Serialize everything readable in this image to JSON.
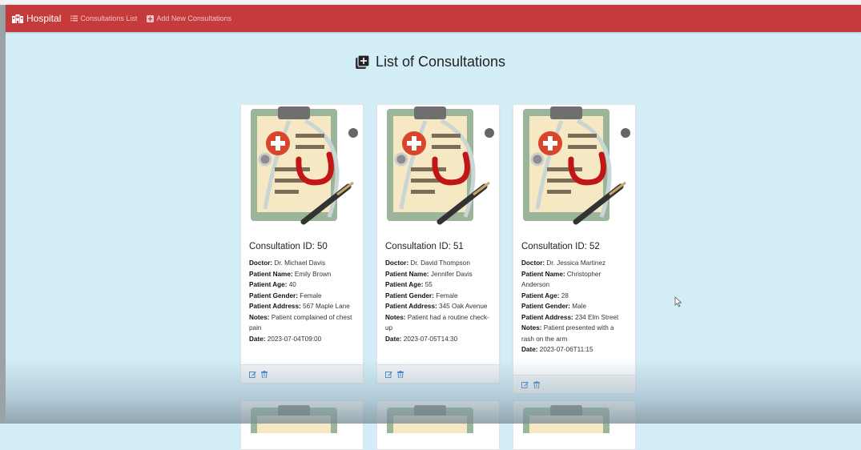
{
  "navbar": {
    "brand": "Hospital",
    "links": [
      {
        "label": "Consultations List",
        "icon": "list-icon"
      },
      {
        "label": "Add New Consultations",
        "icon": "plus-square-icon"
      }
    ],
    "bg_color": "#c53b3b"
  },
  "page": {
    "title": "List of Consultations",
    "title_icon": "plus-square-icon",
    "bg_color": "#d4eef8"
  },
  "labels": {
    "doctor": "Doctor:",
    "patient_name": "Patient Name:",
    "patient_age": "Patient Age:",
    "patient_gender": "Patient Gender:",
    "patient_address": "Patient Address:",
    "notes": "Notes:",
    "date": "Date:"
  },
  "consultations": [
    {
      "title": "Consultation ID: 50",
      "doctor": "Dr. Michael Davis",
      "patient_name": "Emily Brown",
      "patient_age": "40",
      "patient_gender": "Female",
      "patient_address": "567 Maple Lane",
      "notes": "Patient complained of chest pain",
      "date": "2023-07-04T09:00"
    },
    {
      "title": "Consultation ID: 51",
      "doctor": "Dr. David Thompson",
      "patient_name": "Jennifer Davis",
      "patient_age": "55",
      "patient_gender": "Female",
      "patient_address": "345 Oak Avenue",
      "notes": "Patient had a routine check-up",
      "date": "2023-07-05T14:30"
    },
    {
      "title": "Consultation ID: 52",
      "doctor": "Dr. Jessica Martinez",
      "patient_name": "Christopher Anderson",
      "patient_age": "28",
      "patient_gender": "Male",
      "patient_address": "234 Elm Street",
      "notes": "Patient presented with a rash on the arm",
      "date": "2023-07-06T11:15"
    }
  ],
  "card_actions": [
    {
      "icon": "edit-icon",
      "color": "#3b82c4"
    },
    {
      "icon": "trash-icon",
      "color": "#3b82c4"
    }
  ]
}
